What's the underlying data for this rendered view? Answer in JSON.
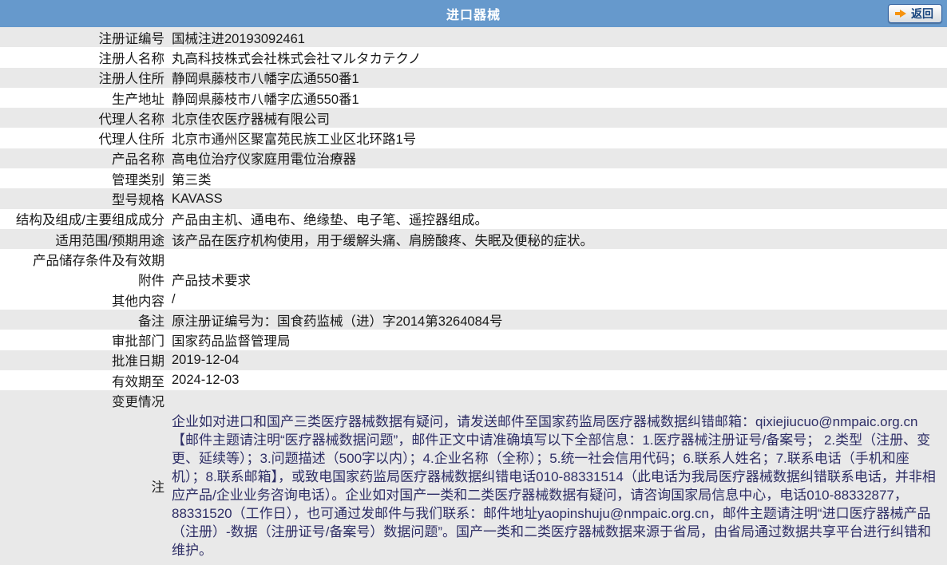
{
  "header": {
    "title": "进口器械",
    "back_label": "返回",
    "back_icon": "arrow-right-icon"
  },
  "colors": {
    "header_bg": "#6699cc",
    "row_stripe": "#e9e9e9",
    "note_text": "#2e2e66",
    "back_arrow_orange": "#f6930f",
    "back_text_blue": "#17447e"
  },
  "table": {
    "rows": [
      {
        "label": "注册证编号",
        "value": "国械注进20193092461"
      },
      {
        "label": "注册人名称",
        "value": "丸高科技株式会社株式会社マルタカテクノ"
      },
      {
        "label": "注册人住所",
        "value": "静岡県藤枝市八幡字広通550番1"
      },
      {
        "label": "生产地址",
        "value": "静岡県藤枝市八幡字広通550番1"
      },
      {
        "label": "代理人名称",
        "value": "北京佳农医疗器械有限公司"
      },
      {
        "label": "代理人住所",
        "value": "北京市通州区聚富苑民族工业区北环路1号"
      },
      {
        "label": "产品名称",
        "value": "高电位治疗仪家庭用電位治療器"
      },
      {
        "label": "管理类别",
        "value": "第三类"
      },
      {
        "label": "型号规格",
        "value": "KAVASS"
      },
      {
        "label": "结构及组成/主要组成成分",
        "value": "产品由主机、通电布、绝缘垫、电子笔、遥控器组成。"
      },
      {
        "label": "适用范围/预期用途",
        "value": "该产品在医疗机构使用，用于缓解头痛、肩膀酸疼、失眠及便秘的症状。"
      },
      {
        "label": "产品储存条件及有效期",
        "value": ""
      },
      {
        "label": "附件",
        "value": "产品技术要求"
      },
      {
        "label": "其他内容",
        "value": "/"
      },
      {
        "label": "备注",
        "value": "原注册证编号为：国食药监械（进）字2014第3264084号"
      },
      {
        "label": "审批部门",
        "value": "国家药品监督管理局"
      },
      {
        "label": "批准日期",
        "value": "2019-12-04"
      },
      {
        "label": "有效期至",
        "value": "2024-12-03"
      },
      {
        "label": "变更情况",
        "value": ""
      }
    ]
  },
  "note": {
    "label": "注",
    "text": "企业如对进口和国产三类医疗器械数据有疑问，请发送邮件至国家药监局医疗器械数据纠错邮箱：qixiejiucuo@nmpaic.org.cn【邮件主题请注明“医疗器械数据问题”，邮件正文中请准确填写以下全部信息：1.医疗器械注册证号/备案号； 2.类型（注册、变更、延续等）；3.问题描述（500字以内）；4.企业名称（全称）；5.统一社会信用代码；6.联系人姓名；7.联系电话（手机和座机）；8.联系邮箱】，或致电国家药监局医疗器械数据纠错电话010-88331514（此电话为我局医疗器械数据纠错联系电话，并非相应产品/企业业务咨询电话）。企业如对国产一类和二类医疗器械数据有疑问，请咨询国家局信息中心，电话010-88332877，88331520（工作日），也可通过发邮件与我们联系：邮件地址yaopinshuju@nmpaic.org.cn，邮件主题请注明“进口医疗器械产品（注册）-数据（注册证号/备案号）数据问题”。国产一类和二类医疗器械数据来源于省局，由省局通过数据共享平台进行纠错和维护。"
  }
}
